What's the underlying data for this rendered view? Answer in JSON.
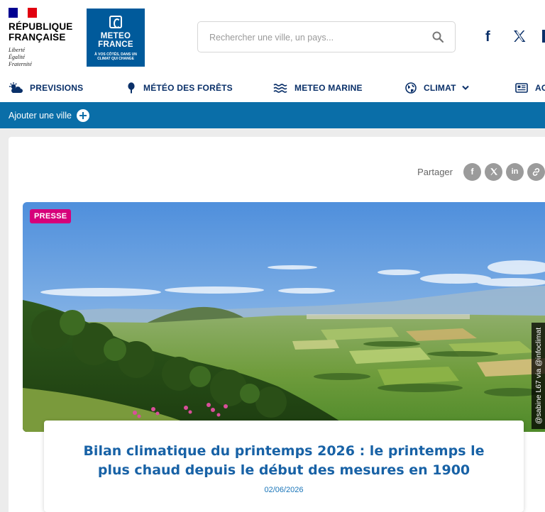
{
  "header": {
    "rf_title_line1": "RÉPUBLIQUE",
    "rf_title_line2": "FRANÇAISE",
    "rf_motto_1": "Liberté",
    "rf_motto_2": "Égalité",
    "rf_motto_3": "Fraternité",
    "mf_name_1": "METEO",
    "mf_name_2": "FRANCE",
    "mf_tagline": "À VOS CÔTÉS, DANS UN CLIMAT QUI CHANGE",
    "search_placeholder": "Rechercher une ville, un pays...",
    "social": [
      "facebook-icon",
      "x-icon"
    ]
  },
  "nav": {
    "items": [
      {
        "label": "PREVISIONS",
        "icon": "cloud-sun-icon"
      },
      {
        "label": "MÉTÉO DES FORÊTS",
        "icon": "tree-icon"
      },
      {
        "label": "METEO MARINE",
        "icon": "waves-icon"
      },
      {
        "label": "CLIMAT",
        "icon": "globe-icon",
        "dropdown": true
      },
      {
        "label": "AC",
        "icon": "news-icon"
      }
    ]
  },
  "citybar": {
    "add_city_label": "Ajouter une ville"
  },
  "article": {
    "share_label": "Partager",
    "share_buttons": [
      "facebook-icon",
      "x-icon",
      "linkedin-icon",
      "link-icon"
    ],
    "badge": "PRESSE",
    "photo_credit": "@sabine L67 via @infoclimat",
    "title": "Bilan climatique du printemps 2026 : le printemps le plus chaud depuis le début des mesures en 1900",
    "date": "02/06/2026"
  },
  "colors": {
    "brand_blue": "#005a9b",
    "nav_text": "#0a3069",
    "city_bar": "#0a6ea8",
    "badge": "#d6007a",
    "title": "#1862a6"
  }
}
